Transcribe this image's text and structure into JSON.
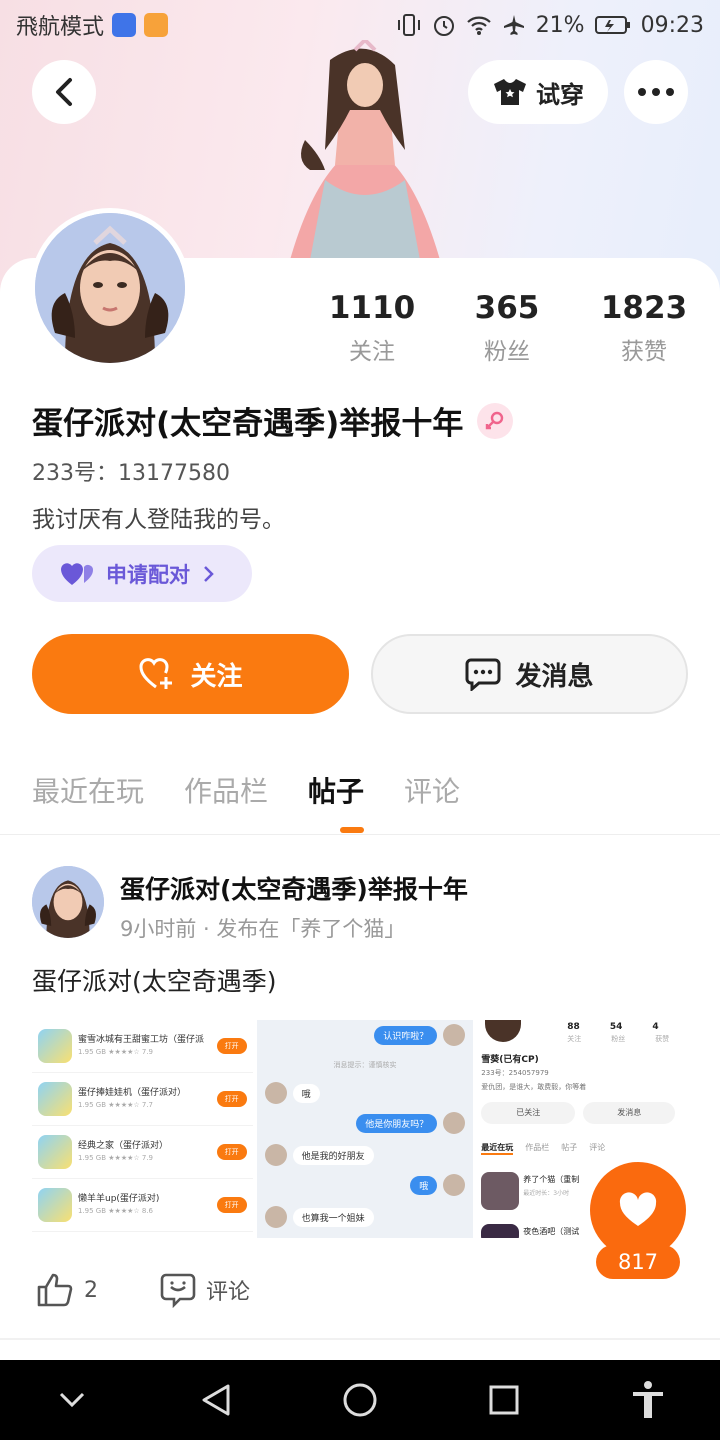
{
  "status_bar": {
    "mode_label": "飛航模式",
    "battery": "21%",
    "time": "09:23"
  },
  "header": {
    "try_on_label": "试穿"
  },
  "profile": {
    "stats": [
      {
        "value": "1110",
        "label": "关注"
      },
      {
        "value": "365",
        "label": "粉丝"
      },
      {
        "value": "1823",
        "label": "获赞"
      }
    ],
    "name": "蛋仔派对(太空奇遇季)举报十年",
    "uid": "233号：13177580",
    "bio": "我讨厌有人登陆我的号。",
    "pair_label": "申请配对"
  },
  "buttons": {
    "follow": "关注",
    "message": "发消息"
  },
  "tabs": [
    "最近在玩",
    "作品栏",
    "帖子",
    "评论"
  ],
  "active_tab": 2,
  "post": {
    "author": "蛋仔派对(太空奇遇季)举报十年",
    "meta": "9小时前 · 发布在「养了个猫」",
    "text": "蛋仔派对(太空奇遇季)",
    "likes": "2",
    "comment_label": "评论",
    "images": {
      "apps": [
        {
          "title": "蜜雪冰城有王甜蜜工坊（蛋仔派",
          "sub": "1.95 GB ★★★★☆ 7.9",
          "btn": "打开"
        },
        {
          "title": "蛋仔捧娃娃机（蛋仔派对）",
          "sub": "1.95 GB ★★★★☆ 7.7",
          "btn": "打开"
        },
        {
          "title": "经典之家（蛋仔派对）",
          "sub": "1.95 GB ★★★★☆ 7.9",
          "btn": "打开"
        },
        {
          "title": "懒羊羊up(蛋仔派对)",
          "sub": "1.95 GB ★★★★☆ 8.6",
          "btn": "打开"
        }
      ],
      "chat": {
        "m1": "认识咋啦？",
        "notice": "消息提示：谨慎核实",
        "m2": "哦",
        "m3": "他是你朋友吗？",
        "m4": "他是我的好朋友",
        "m5": "哦",
        "m6": "也算我一个姐妹"
      },
      "profile_shot": {
        "stats": [
          "88",
          "54",
          "4"
        ],
        "stat_labels": [
          "关注",
          "粉丝",
          "获赞"
        ],
        "name": "雪葵(已有CP)",
        "uid": "233号：254057979",
        "bio": "爱仇团，是谁大，敢费毅，你等着",
        "follow_btn": "已关注",
        "msg_btn": "发消息",
        "tabs": [
          "最近在玩",
          "作品栏",
          "帖子",
          "评论"
        ],
        "game1": "养了个猫（重制",
        "game1_sub": "最近时长：3小时",
        "game2": "夜色酒吧（测试"
      }
    }
  },
  "fab": {
    "count": "817"
  },
  "colors": {
    "accent": "#fa7a10",
    "purple": "#6a58d8"
  }
}
